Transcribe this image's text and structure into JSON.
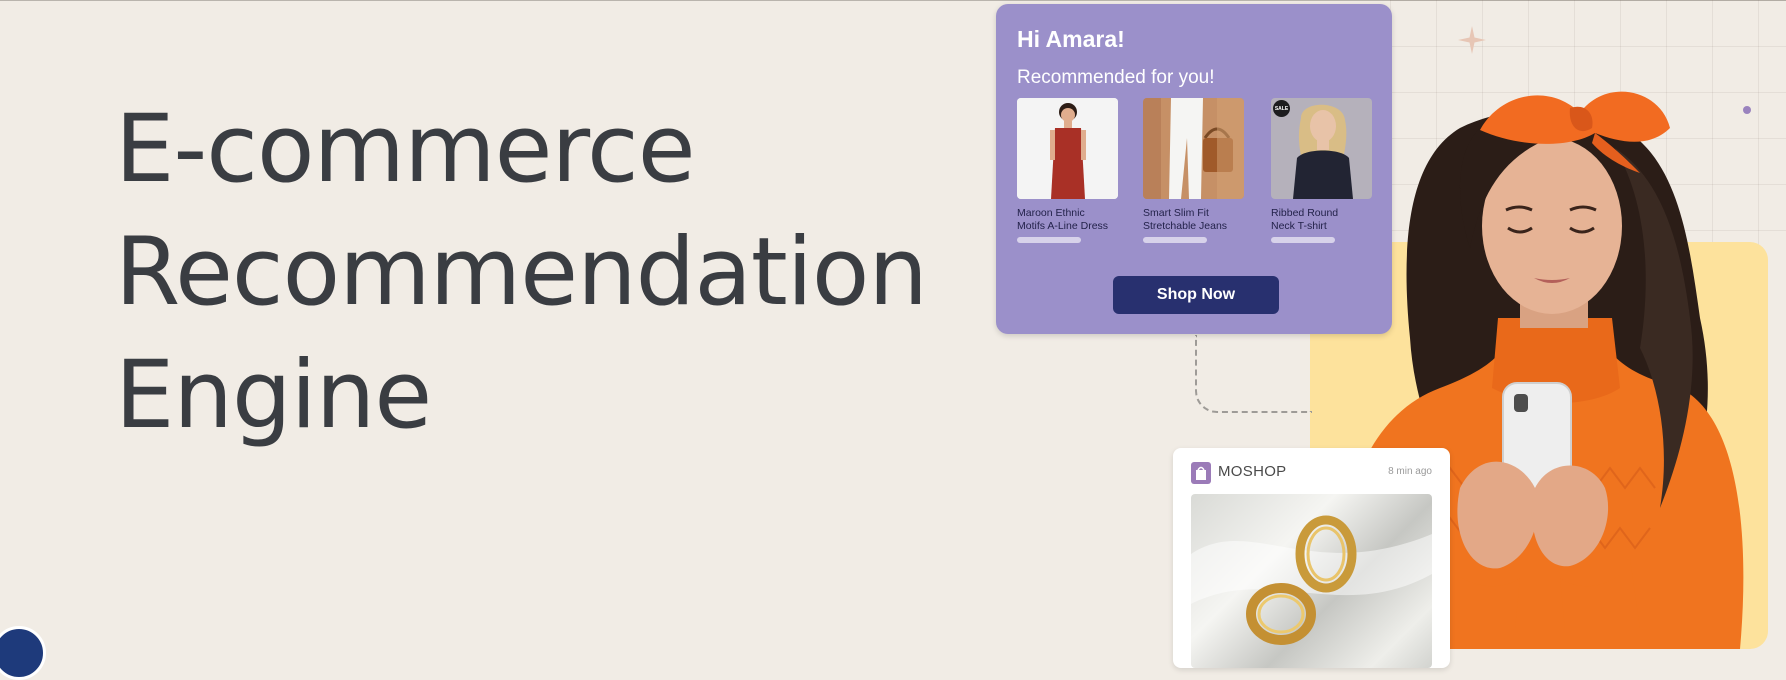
{
  "hero": {
    "title_lines": [
      "E-commerce",
      "Recommendation",
      "Engine"
    ]
  },
  "recommendation_card": {
    "greeting": "Hi Amara!",
    "subheading": "Recommended for you!",
    "products": [
      {
        "name_line1": "Maroon Ethnic",
        "name_line2": "Motifs A-Line Dress"
      },
      {
        "name_line1": "Smart Slim Fit",
        "name_line2": "Stretchable Jeans"
      },
      {
        "name_line1": "Ribbed Round",
        "name_line2": "Neck T-shirt",
        "badge": "SALE"
      }
    ],
    "button_label": "Shop Now"
  },
  "notification_card": {
    "brand": "MOSHOP",
    "timestamp": "8 min ago"
  },
  "colors": {
    "background": "#f1ece5",
    "card_purple": "#9b90ca",
    "button_navy": "#28306f",
    "accent_yellow": "#fde29c",
    "sweater_orange": "#f0741f"
  },
  "icons": [
    "sparkle-icon",
    "shop-bag-icon"
  ]
}
